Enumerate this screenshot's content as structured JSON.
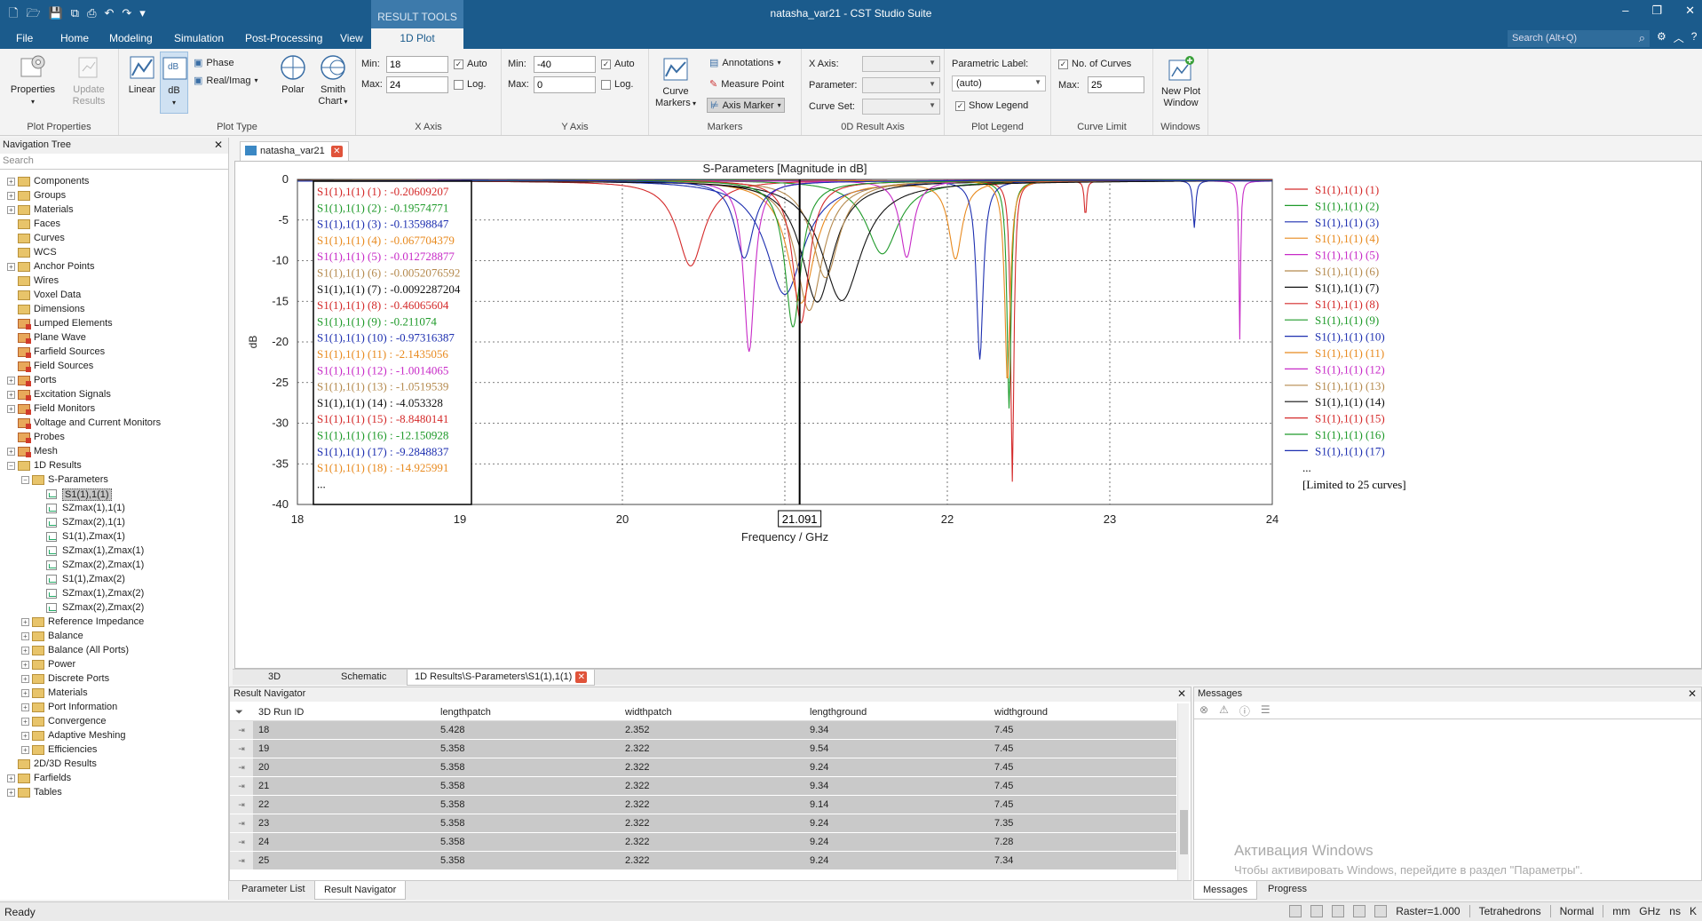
{
  "app": {
    "title": "natasha_var21 - CST Studio Suite",
    "context_group": "RESULT TOOLS",
    "context_tab": "1D Plot",
    "tabs": [
      "File",
      "Home",
      "Modeling",
      "Simulation",
      "Post-Processing",
      "View"
    ],
    "search_placeholder": "Search (Alt+Q)"
  },
  "ribbon": {
    "plot_properties": {
      "label": "Plot Properties",
      "properties": "Properties",
      "update_results": "Update Results"
    },
    "plot_type": {
      "label": "Plot Type",
      "linear": "Linear",
      "db": "dB",
      "phase": "Phase",
      "realimag": "Real/Imag",
      "polar": "Polar",
      "smith": "Smith Chart"
    },
    "x_axis": {
      "label": "X Axis",
      "min_label": "Min:",
      "max_label": "Max:",
      "min": "18",
      "max": "24",
      "auto": "Auto",
      "log": "Log."
    },
    "y_axis": {
      "label": "Y Axis",
      "min_label": "Min:",
      "max_label": "Max:",
      "min": "-40",
      "max": "0",
      "auto": "Auto",
      "log": "Log."
    },
    "markers": {
      "label": "Markers",
      "curve_markers": "Curve Markers",
      "annotations": "Annotations",
      "measure_point": "Measure Point",
      "axis_marker": "Axis Marker"
    },
    "result_axis": {
      "label": "0D Result Axis",
      "x_axis": "X Axis:",
      "parameter": "Parameter:",
      "curve_set": "Curve Set:"
    },
    "plot_legend": {
      "label": "Plot Legend",
      "parametric_label": "Parametric Label:",
      "value": "(auto)",
      "show_legend": "Show Legend"
    },
    "curve_limit": {
      "label": "Curve Limit",
      "no_of_curves": "No. of Curves",
      "max_label": "Max:",
      "max": "25"
    },
    "windows": {
      "label": "Windows",
      "new_plot_window": "New Plot Window"
    }
  },
  "navigation": {
    "title": "Navigation Tree",
    "search": "Search",
    "items": [
      {
        "label": "Components",
        "level": 0,
        "exp": "+",
        "icon": "folder"
      },
      {
        "label": "Groups",
        "level": 0,
        "exp": "+",
        "icon": "folder"
      },
      {
        "label": "Materials",
        "level": 0,
        "exp": "+",
        "icon": "folder"
      },
      {
        "label": "Faces",
        "level": 0,
        "exp": "",
        "icon": "folder"
      },
      {
        "label": "Curves",
        "level": 0,
        "exp": "",
        "icon": "folder"
      },
      {
        "label": "WCS",
        "level": 0,
        "exp": "",
        "icon": "folder"
      },
      {
        "label": "Anchor Points",
        "level": 0,
        "exp": "+",
        "icon": "folder"
      },
      {
        "label": "Wires",
        "level": 0,
        "exp": "",
        "icon": "folder"
      },
      {
        "label": "Voxel Data",
        "level": 0,
        "exp": "",
        "icon": "folder"
      },
      {
        "label": "Dimensions",
        "level": 0,
        "exp": "",
        "icon": "folder"
      },
      {
        "label": "Lumped Elements",
        "level": 0,
        "exp": "",
        "icon": "red"
      },
      {
        "label": "Plane Wave",
        "level": 0,
        "exp": "",
        "icon": "red"
      },
      {
        "label": "Farfield Sources",
        "level": 0,
        "exp": "",
        "icon": "red"
      },
      {
        "label": "Field Sources",
        "level": 0,
        "exp": "",
        "icon": "red"
      },
      {
        "label": "Ports",
        "level": 0,
        "exp": "+",
        "icon": "red"
      },
      {
        "label": "Excitation Signals",
        "level": 0,
        "exp": "+",
        "icon": "red"
      },
      {
        "label": "Field Monitors",
        "level": 0,
        "exp": "+",
        "icon": "red"
      },
      {
        "label": "Voltage and Current Monitors",
        "level": 0,
        "exp": "",
        "icon": "red"
      },
      {
        "label": "Probes",
        "level": 0,
        "exp": "",
        "icon": "red"
      },
      {
        "label": "Mesh",
        "level": 0,
        "exp": "+",
        "icon": "red"
      },
      {
        "label": "1D Results",
        "level": 0,
        "exp": "−",
        "icon": "folder"
      },
      {
        "label": "S-Parameters",
        "level": 1,
        "exp": "−",
        "icon": "folder"
      },
      {
        "label": "S1(1),1(1)",
        "level": 2,
        "exp": "",
        "icon": "plot",
        "selected": true
      },
      {
        "label": "SZmax(1),1(1)",
        "level": 2,
        "exp": "",
        "icon": "plot"
      },
      {
        "label": "SZmax(2),1(1)",
        "level": 2,
        "exp": "",
        "icon": "plot"
      },
      {
        "label": "S1(1),Zmax(1)",
        "level": 2,
        "exp": "",
        "icon": "plot"
      },
      {
        "label": "SZmax(1),Zmax(1)",
        "level": 2,
        "exp": "",
        "icon": "plot"
      },
      {
        "label": "SZmax(2),Zmax(1)",
        "level": 2,
        "exp": "",
        "icon": "plot"
      },
      {
        "label": "S1(1),Zmax(2)",
        "level": 2,
        "exp": "",
        "icon": "plot"
      },
      {
        "label": "SZmax(1),Zmax(2)",
        "level": 2,
        "exp": "",
        "icon": "plot"
      },
      {
        "label": "SZmax(2),Zmax(2)",
        "level": 2,
        "exp": "",
        "icon": "plot"
      },
      {
        "label": "Reference Impedance",
        "level": 1,
        "exp": "+",
        "icon": "folder"
      },
      {
        "label": "Balance",
        "level": 1,
        "exp": "+",
        "icon": "folder"
      },
      {
        "label": "Balance (All Ports)",
        "level": 1,
        "exp": "+",
        "icon": "folder"
      },
      {
        "label": "Power",
        "level": 1,
        "exp": "+",
        "icon": "folder"
      },
      {
        "label": "Discrete Ports",
        "level": 1,
        "exp": "+",
        "icon": "folder"
      },
      {
        "label": "Materials",
        "level": 1,
        "exp": "+",
        "icon": "folder"
      },
      {
        "label": "Port Information",
        "level": 1,
        "exp": "+",
        "icon": "folder"
      },
      {
        "label": "Convergence",
        "level": 1,
        "exp": "+",
        "icon": "folder"
      },
      {
        "label": "Adaptive Meshing",
        "level": 1,
        "exp": "+",
        "icon": "folder"
      },
      {
        "label": "Efficiencies",
        "level": 1,
        "exp": "+",
        "icon": "folder"
      },
      {
        "label": "2D/3D Results",
        "level": 0,
        "exp": "",
        "icon": "folder"
      },
      {
        "label": "Farfields",
        "level": 0,
        "exp": "+",
        "icon": "folder"
      },
      {
        "label": "Tables",
        "level": 0,
        "exp": "+",
        "icon": "folder"
      }
    ]
  },
  "document_tab": "natasha_var21",
  "view_tabs": [
    "3D",
    "Schematic",
    "1D Results\\S-Parameters\\S1(1),1(1)"
  ],
  "chart_data": {
    "type": "line",
    "title": "S-Parameters [Magnitude in dB]",
    "xlabel": "Frequency / GHz",
    "ylabel": "dB",
    "xlim": [
      18,
      24
    ],
    "ylim": [
      -40,
      0
    ],
    "xticks": [
      "18",
      "19",
      "20",
      "21",
      "22",
      "23",
      "24"
    ],
    "yticks": [
      "0",
      "-5",
      "-10",
      "-15",
      "-20",
      "-25",
      "-30",
      "-35",
      "-40"
    ],
    "grid": true,
    "axis_marker": {
      "x": 21.091,
      "label": "21.091"
    },
    "marker_readout": [
      {
        "name": "S1(1),1(1) (1)",
        "value": "-0.20609207",
        "color": "#d42a2a"
      },
      {
        "name": "S1(1),1(1) (2)",
        "value": "-0.19574771",
        "color": "#1f9a2a"
      },
      {
        "name": "S1(1),1(1) (3)",
        "value": "-0.13598847",
        "color": "#1d2fb0"
      },
      {
        "name": "S1(1),1(1) (4)",
        "value": "-0.067704379",
        "color": "#e88a1f"
      },
      {
        "name": "S1(1),1(1) (5)",
        "value": "-0.012728877",
        "color": "#c72ac7"
      },
      {
        "name": "S1(1),1(1) (6)",
        "value": "-0.0052076592",
        "color": "#b58a4e"
      },
      {
        "name": "S1(1),1(1) (7)",
        "value": "-0.0092287204",
        "color": "#111111"
      },
      {
        "name": "S1(1),1(1) (8)",
        "value": "-0.46065604",
        "color": "#d42a2a"
      },
      {
        "name": "S1(1),1(1) (9)",
        "value": "-0.211074",
        "color": "#1f9a2a"
      },
      {
        "name": "S1(1),1(1) (10)",
        "value": "-0.97316387",
        "color": "#1d2fb0"
      },
      {
        "name": "S1(1),1(1) (11)",
        "value": "-2.1435056",
        "color": "#e88a1f"
      },
      {
        "name": "S1(1),1(1) (12)",
        "value": "-1.0014065",
        "color": "#c72ac7"
      },
      {
        "name": "S1(1),1(1) (13)",
        "value": "-1.0519539",
        "color": "#b58a4e"
      },
      {
        "name": "S1(1),1(1) (14)",
        "value": "-4.053328",
        "color": "#111111"
      },
      {
        "name": "S1(1),1(1) (15)",
        "value": "-8.8480141",
        "color": "#d42a2a"
      },
      {
        "name": "S1(1),1(1) (16)",
        "value": "-12.150928",
        "color": "#1f9a2a"
      },
      {
        "name": "S1(1),1(1) (17)",
        "value": "-9.2848837",
        "color": "#1d2fb0"
      },
      {
        "name": "S1(1),1(1) (18)",
        "value": "-14.925991",
        "color": "#e88a1f"
      }
    ],
    "readout_more": "...",
    "legend_more": "...",
    "legend_note": "[Limited to 25 curves]",
    "series": [
      {
        "name": "S1(1),1(1) (1)",
        "color": "#d42a2a",
        "dips": [
          [
            20.42,
            -10.5,
            0.1
          ],
          [
            22.85,
            -4.5,
            0.008
          ]
        ]
      },
      {
        "name": "S1(1),1(1) (2)",
        "color": "#1f9a2a",
        "dips": [
          [
            21.6,
            -9,
            0.12
          ]
        ]
      },
      {
        "name": "S1(1),1(1) (3)",
        "color": "#1d2fb0",
        "dips": [
          [
            21.0,
            -14,
            0.14
          ],
          [
            23.52,
            -5.8,
            0.01
          ]
        ]
      },
      {
        "name": "S1(1),1(1) (4)",
        "color": "#e88a1f",
        "dips": [
          [
            21.1,
            -15,
            0.1
          ],
          [
            22.05,
            -9.5,
            0.05
          ]
        ]
      },
      {
        "name": "S1(1),1(1) (5)",
        "color": "#c72ac7",
        "dips": [
          [
            20.78,
            -21,
            0.04
          ],
          [
            23.8,
            -19.5,
            0.006
          ]
        ]
      },
      {
        "name": "S1(1),1(1) (6)",
        "color": "#b58a4e",
        "dips": [
          [
            21.15,
            -16,
            0.1
          ]
        ]
      },
      {
        "name": "S1(1),1(1) (7)",
        "color": "#111111",
        "dips": [
          [
            21.2,
            -15,
            0.12
          ]
        ]
      },
      {
        "name": "S1(1),1(1) (8)",
        "color": "#d42a2a",
        "dips": [
          [
            22.4,
            -37,
            0.012
          ]
        ]
      },
      {
        "name": "S1(1),1(1) (9)",
        "color": "#1f9a2a",
        "dips": [
          [
            22.38,
            -28,
            0.015
          ]
        ]
      },
      {
        "name": "S1(1),1(1) (10)",
        "color": "#1d2fb0",
        "dips": [
          [
            22.2,
            -22,
            0.025
          ]
        ]
      },
      {
        "name": "S1(1),1(1) (11)",
        "color": "#e88a1f",
        "dips": [
          [
            22.37,
            -25,
            0.02
          ]
        ]
      },
      {
        "name": "S1(1),1(1) (12)",
        "color": "#c72ac7",
        "dips": [
          [
            21.75,
            -9.5,
            0.05
          ]
        ]
      },
      {
        "name": "S1(1),1(1) (13)",
        "color": "#b58a4e",
        "dips": [
          [
            21.25,
            -12,
            0.1
          ]
        ]
      },
      {
        "name": "S1(1),1(1) (14)",
        "color": "#111111",
        "dips": [
          [
            21.35,
            -14.8,
            0.15
          ]
        ]
      },
      {
        "name": "S1(1),1(1) (15)",
        "color": "#d42a2a",
        "dips": [
          [
            21.1,
            -17.5,
            0.06
          ]
        ]
      },
      {
        "name": "S1(1),1(1) (16)",
        "color": "#1f9a2a",
        "dips": [
          [
            21.05,
            -18,
            0.06
          ]
        ]
      },
      {
        "name": "S1(1),1(1) (17)",
        "color": "#1d2fb0",
        "dips": [
          [
            20.75,
            -9.5,
            0.07
          ]
        ]
      }
    ]
  },
  "result_navigator": {
    "title": "Result Navigator",
    "columns": [
      "3D Run ID",
      "lengthpatch",
      "widthpatch",
      "lengthground",
      "widthground"
    ],
    "rows": [
      [
        "18",
        "5.428",
        "2.352",
        "9.34",
        "7.45"
      ],
      [
        "19",
        "5.358",
        "2.322",
        "9.54",
        "7.45"
      ],
      [
        "20",
        "5.358",
        "2.322",
        "9.24",
        "7.45"
      ],
      [
        "21",
        "5.358",
        "2.322",
        "9.34",
        "7.45"
      ],
      [
        "22",
        "5.358",
        "2.322",
        "9.14",
        "7.45"
      ],
      [
        "23",
        "5.358",
        "2.322",
        "9.24",
        "7.35"
      ],
      [
        "24",
        "5.358",
        "2.322",
        "9.24",
        "7.28"
      ],
      [
        "25",
        "5.358",
        "2.322",
        "9.24",
        "7.34"
      ]
    ],
    "tabs": [
      "Parameter List",
      "Result Navigator"
    ]
  },
  "messages": {
    "title": "Messages",
    "tabs": [
      "Messages",
      "Progress"
    ],
    "activation_title": "Активация Windows",
    "activation_text": "Чтобы активировать Windows, перейдите в раздел \"Параметры\"."
  },
  "status": {
    "ready": "Ready",
    "raster": "Raster=1.000",
    "mesh": "Tetrahedrons",
    "mode": "Normal",
    "units": [
      "mm",
      "GHz",
      "ns",
      "K"
    ]
  }
}
